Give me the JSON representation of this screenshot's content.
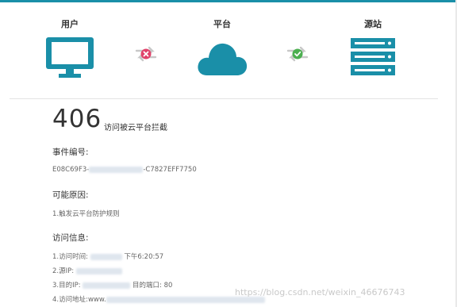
{
  "top": {
    "user": "用户",
    "platform": "平台",
    "origin": "源站"
  },
  "icons": {
    "user": "monitor-icon",
    "platform": "cloud-icon",
    "origin": "server-icon",
    "blocked": "arrows-blocked-icon",
    "ok": "arrows-ok-icon",
    "brand_color": "#1a8fa8",
    "blocked_color": "#e0436b",
    "ok_color": "#4caf50"
  },
  "error": {
    "code": "406",
    "desc": "访问被云平台拦截"
  },
  "event": {
    "title": "事件编号:",
    "id_prefix": "E08C69F3-",
    "id_suffix": "-C7827EFF7750"
  },
  "reason": {
    "title": "可能原因:",
    "item1": "1.触发云平台防护规则"
  },
  "access": {
    "title": "访问信息:",
    "time_label": "1.访问时间:",
    "time_value": "下午6:20:57",
    "src_ip_label": "2.源IP:",
    "dest_ip_label": "3.目的IP:",
    "dest_port_label": "目的端口:",
    "dest_port_value": "80",
    "url_label": "4.访问地址:",
    "url_value": "www."
  },
  "watermark": "https://blog.csdn.net/weixin_46676743"
}
